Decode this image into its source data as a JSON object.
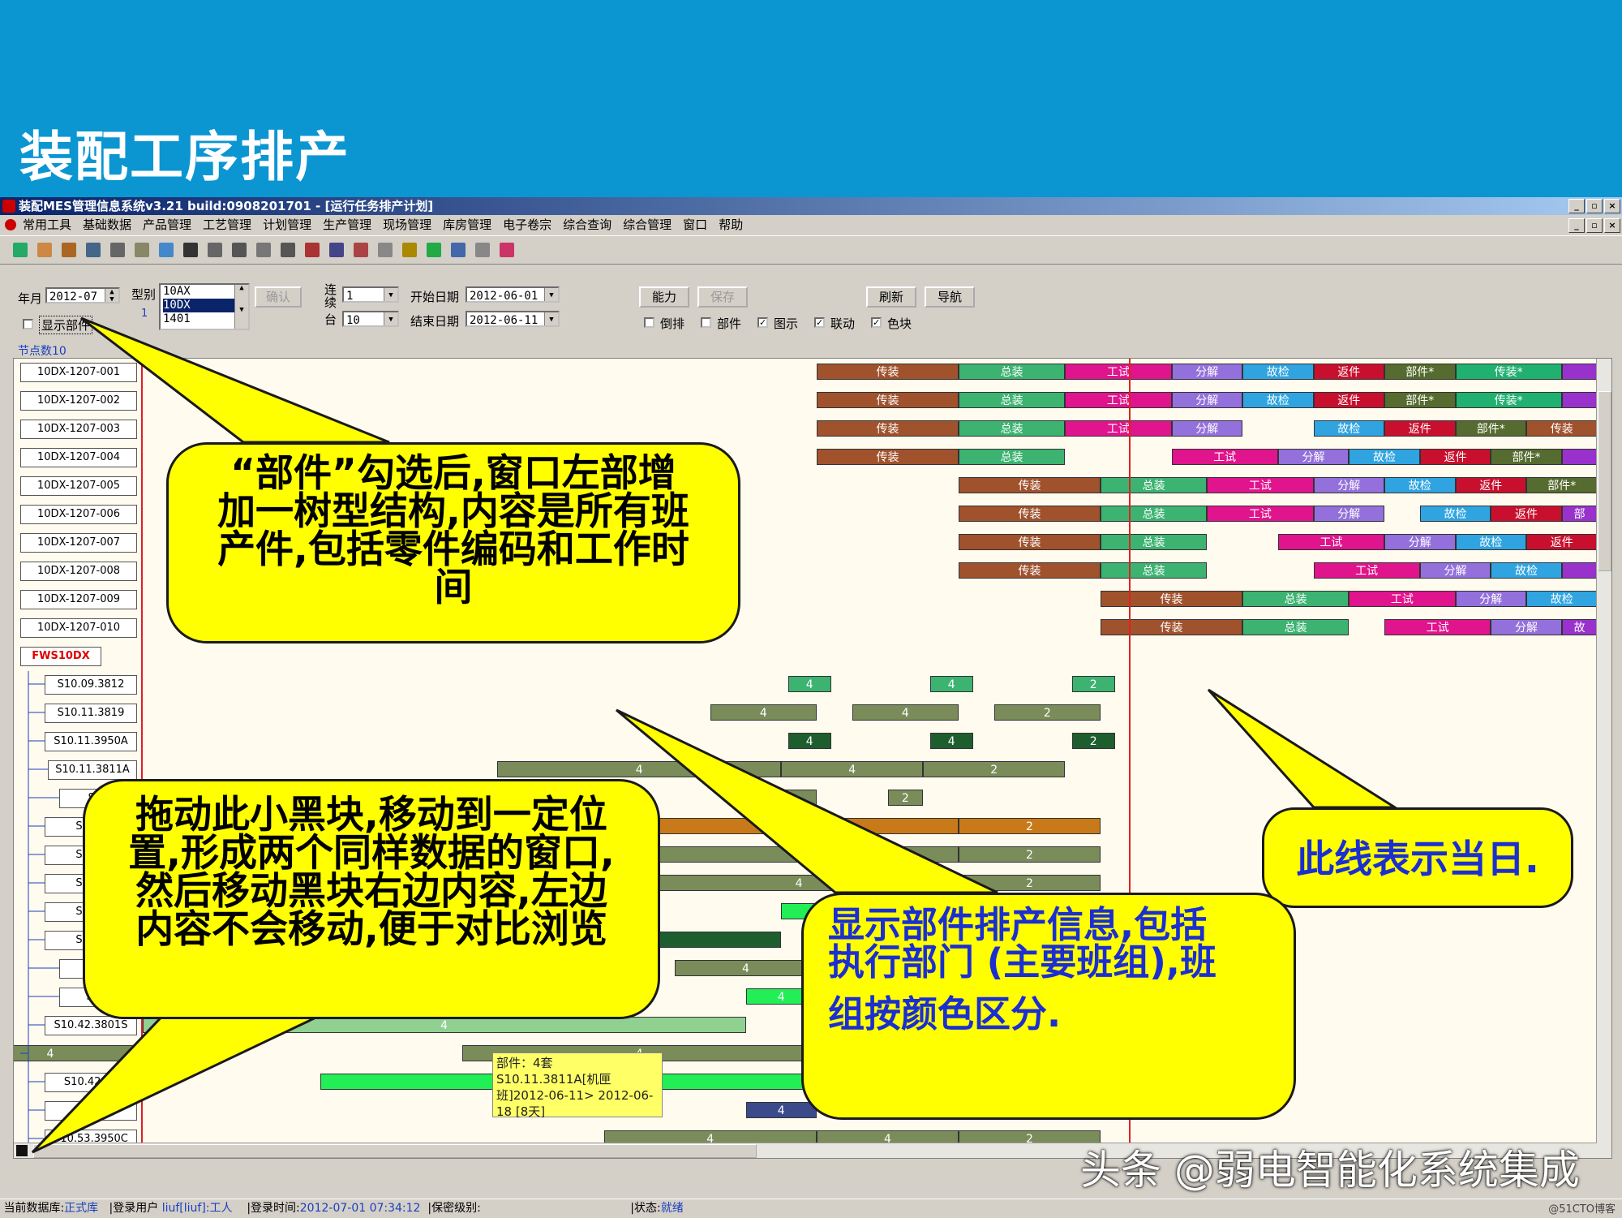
{
  "slide": {
    "title": "装配工序排产"
  },
  "window": {
    "title": "装配MES管理信息系统v3.21 build:0908201701 - [运行任务排产计划]",
    "menu": [
      "常用工具",
      "基础数据",
      "产品管理",
      "工艺管理",
      "计划管理",
      "生产管理",
      "现场管理",
      "库房管理",
      "电子卷宗",
      "综合查询",
      "综合管理",
      "窗口",
      "帮助"
    ]
  },
  "filters": {
    "year_month_label": "年月",
    "year_month": "2012-07",
    "type_label": "型别",
    "type_options": [
      "10AX",
      "10DX",
      "1401"
    ],
    "type_selected": "10DX",
    "type_count": "1",
    "confirm": "确认",
    "consecutive_label": "连续",
    "consecutive": "1",
    "tai_label": "台",
    "tai": "10",
    "start_date_label": "开始日期",
    "start_date": "2012-06-01",
    "end_date_label": "结束日期",
    "end_date": "2012-06-11",
    "capacity": "能力",
    "save": "保存",
    "refresh": "刷新",
    "navigate": "导航",
    "show_parts": "显示部件",
    "checks": [
      {
        "label": "倒排",
        "checked": false
      },
      {
        "label": "部件",
        "checked": false
      },
      {
        "label": "图示",
        "checked": true
      },
      {
        "label": "联动",
        "checked": true
      },
      {
        "label": "色块",
        "checked": true
      }
    ]
  },
  "gantt": {
    "node_count": "节点数10",
    "tasks": [
      "10DX-1207-001",
      "10DX-1207-002",
      "10DX-1207-003",
      "10DX-1207-004",
      "10DX-1207-005",
      "10DX-1207-006",
      "10DX-1207-007",
      "10DX-1207-008",
      "10DX-1207-009",
      "10DX-1207-010"
    ],
    "root": "FWS10DX",
    "parts": [
      "S10.09.3812",
      "S10.11.3819",
      "S10.11.3950A",
      "S10.11.3811A",
      "S10",
      "S10.1",
      "S10.1",
      "S10.1",
      "S10.1",
      "S10.4",
      "S10",
      "S10.",
      "S10.42.3801S",
      "",
      "S10.42.38",
      "S10",
      "S10.53.3950C"
    ],
    "stage_colors": {
      "传装": "#a0522d",
      "总装": "#3cb371",
      "工试": "#e0148c",
      "分解": "#9370db",
      "故检": "#2fa4e0",
      "返件": "#c8102e",
      "部件*": "#556b2f",
      "传装*": "#20b070",
      "purple": "#9932cc"
    },
    "task_rows": [
      [
        [
          "传装",
          0,
          10
        ],
        [
          "总装",
          10,
          17.5
        ],
        [
          "工试",
          17.5,
          25
        ],
        [
          "分解",
          25,
          30
        ],
        [
          "故检",
          30,
          35
        ],
        [
          "返件",
          35,
          40
        ],
        [
          "部件*",
          40,
          45
        ],
        [
          "传装*",
          45,
          52.5
        ],
        [
          "",
          52.5,
          55
        ]
      ],
      [
        [
          "传装",
          0,
          10
        ],
        [
          "总装",
          10,
          17.5
        ],
        [
          "工试",
          17.5,
          25
        ],
        [
          "分解",
          25,
          30
        ],
        [
          "故检",
          30,
          35
        ],
        [
          "返件",
          35,
          40
        ],
        [
          "部件*",
          40,
          45
        ],
        [
          "传装*",
          45,
          52.5
        ],
        [
          "",
          52.5,
          55
        ]
      ],
      [
        [
          "传装",
          0,
          10
        ],
        [
          "总装",
          10,
          17.5
        ],
        [
          "工试",
          17.5,
          25
        ],
        [
          "分解",
          25,
          30
        ],
        [
          "故检",
          35,
          40
        ],
        [
          "返件",
          40,
          45
        ],
        [
          "部件*",
          45,
          50
        ],
        [
          "传装",
          50,
          55
        ]
      ],
      [
        [
          "传装",
          0,
          10
        ],
        [
          "总装",
          10,
          17.5
        ],
        [
          "工试",
          25,
          32.5
        ],
        [
          "分解",
          32.5,
          37.5
        ],
        [
          "故检",
          37.5,
          42.5
        ],
        [
          "返件",
          42.5,
          47.5
        ],
        [
          "部件*",
          47.5,
          52.5
        ],
        [
          "",
          52.5,
          55
        ]
      ],
      [
        [
          "传装",
          10,
          20
        ],
        [
          "总装",
          20,
          27.5
        ],
        [
          "工试",
          27.5,
          35
        ],
        [
          "分解",
          35,
          40
        ],
        [
          "故检",
          40,
          45
        ],
        [
          "返件",
          45,
          50
        ],
        [
          "部件*",
          50,
          55
        ]
      ],
      [
        [
          "传装",
          10,
          20
        ],
        [
          "总装",
          20,
          27.5
        ],
        [
          "工试",
          27.5,
          35
        ],
        [
          "分解",
          35,
          40
        ],
        [
          "故检",
          42.5,
          47.5
        ],
        [
          "返件",
          47.5,
          52.5
        ],
        [
          "部",
          52.5,
          55
        ]
      ],
      [
        [
          "传装",
          10,
          20
        ],
        [
          "总装",
          20,
          27.5
        ],
        [
          "工试",
          32.5,
          40
        ],
        [
          "分解",
          40,
          45
        ],
        [
          "故检",
          45,
          50
        ],
        [
          "返件",
          50,
          55
        ]
      ],
      [
        [
          "传装",
          10,
          20
        ],
        [
          "总装",
          20,
          27.5
        ],
        [
          "工试",
          35,
          42.5
        ],
        [
          "分解",
          42.5,
          47.5
        ],
        [
          "故检",
          47.5,
          52.5
        ],
        [
          "",
          52.5,
          55
        ]
      ],
      [
        [
          "传装",
          20,
          30
        ],
        [
          "总装",
          30,
          37.5
        ],
        [
          "工试",
          37.5,
          45
        ],
        [
          "分解",
          45,
          50
        ],
        [
          "故检",
          50,
          55
        ]
      ],
      [
        [
          "传装",
          20,
          30
        ],
        [
          "总装",
          30,
          37.5
        ],
        [
          "工试",
          40,
          47.5
        ],
        [
          "分解",
          47.5,
          52.5
        ],
        [
          "故",
          52.5,
          55
        ]
      ]
    ],
    "part_rows": [
      [
        [
          "4",
          -2,
          1,
          "#3cb371"
        ],
        [
          "4",
          8,
          11,
          "#3cb371"
        ],
        [
          "2",
          18,
          21,
          "#3cb371"
        ]
      ],
      [
        [
          "4",
          -7.5,
          0,
          "#7a8c5a"
        ],
        [
          "4",
          2.5,
          10,
          "#7a8c5a"
        ],
        [
          "2",
          12.5,
          20,
          "#7a8c5a"
        ]
      ],
      [
        [
          "4",
          -2,
          1,
          "#1e5e2e"
        ],
        [
          "4",
          8,
          11,
          "#1e5e2e"
        ],
        [
          "2",
          18,
          21,
          "#1e5e2e"
        ]
      ],
      [
        [
          "4",
          -22.5,
          -2.5,
          "#7a8c5a"
        ],
        [
          "4",
          -2.5,
          7.5,
          "#7a8c5a"
        ],
        [
          "2",
          7.5,
          17.5,
          "#7a8c5a"
        ]
      ],
      [
        [
          "2",
          -5,
          0,
          "#7a8c5a"
        ],
        [
          "2",
          5,
          7.5,
          "#7a8c5a"
        ]
      ],
      [
        [
          "4",
          -12.5,
          10,
          "#c87a1a"
        ],
        [
          "2",
          10,
          20,
          "#c87a1a"
        ]
      ],
      [
        [
          "4",
          -12.5,
          10,
          "#7a8c5a"
        ],
        [
          "2",
          10,
          20,
          "#7a8c5a"
        ]
      ],
      [
        [
          "4",
          -12.5,
          10,
          "#7a8c5a"
        ],
        [
          "2",
          10,
          20,
          "#7a8c5a"
        ]
      ],
      [
        [
          "",
          -2.5,
          0,
          "#22ee55"
        ]
      ],
      [
        [
          "4",
          -22.5,
          -2.5,
          "#1e5e2e"
        ]
      ],
      [
        [
          "4",
          -10,
          0,
          "#7a8c5a"
        ]
      ],
      [
        [
          "4",
          -5,
          0,
          "#22ee55"
        ]
      ],
      [
        [
          "4",
          -47.5,
          -5,
          "#90d090"
        ]
      ],
      [
        [
          "4",
          -63,
          -45,
          "#7a8c5a"
        ],
        [
          "4",
          -25,
          0,
          "#7a8c5a"
        ]
      ],
      [
        [
          "4",
          -35,
          0,
          "#22ee55"
        ]
      ],
      [
        [
          "4",
          -5,
          0,
          "#3a4a8a"
        ]
      ],
      [
        [
          "4",
          -15,
          0,
          "#7a8c5a"
        ],
        [
          "4",
          0,
          10,
          "#7a8c5a"
        ],
        [
          "2",
          10,
          20,
          "#7a8c5a"
        ]
      ]
    ],
    "tooltip": "部件：4套 S10.11.3811A[机匣班]2012-06-11> 2012-06-18 [8天]"
  },
  "callouts": {
    "left_top": [
      "“部件”勾选后,窗口左部增",
      "加一树型结构,内容是所有班",
      "产件,包括零件编码和工作时",
      "间"
    ],
    "left_bottom": [
      "拖动此小黑块,移动到一定位",
      "置,形成两个同样数据的窗口,",
      "然后移动黑块右边内容,左边",
      "内容不会移动,便于对比浏览"
    ],
    "right": "此线表示当日.",
    "center": [
      "显示部件排产信息,包括",
      "执行部门 (主要班组),班",
      "",
      "组按颜色区分."
    ]
  },
  "status": {
    "db_label": "当前数据库:",
    "db": "正式库",
    "user_label": "|登录用户",
    "user": "liuf[liuf]:工人",
    "time_label": "|登录时间:",
    "time": "2012-07-01 07:34:12",
    "secret_label": "|保密级别:",
    "state_label": "|状态:",
    "state": "就绪"
  },
  "watermark": "头条 @弱电智能化系统集成",
  "watermark_small": "@51CTO博客"
}
